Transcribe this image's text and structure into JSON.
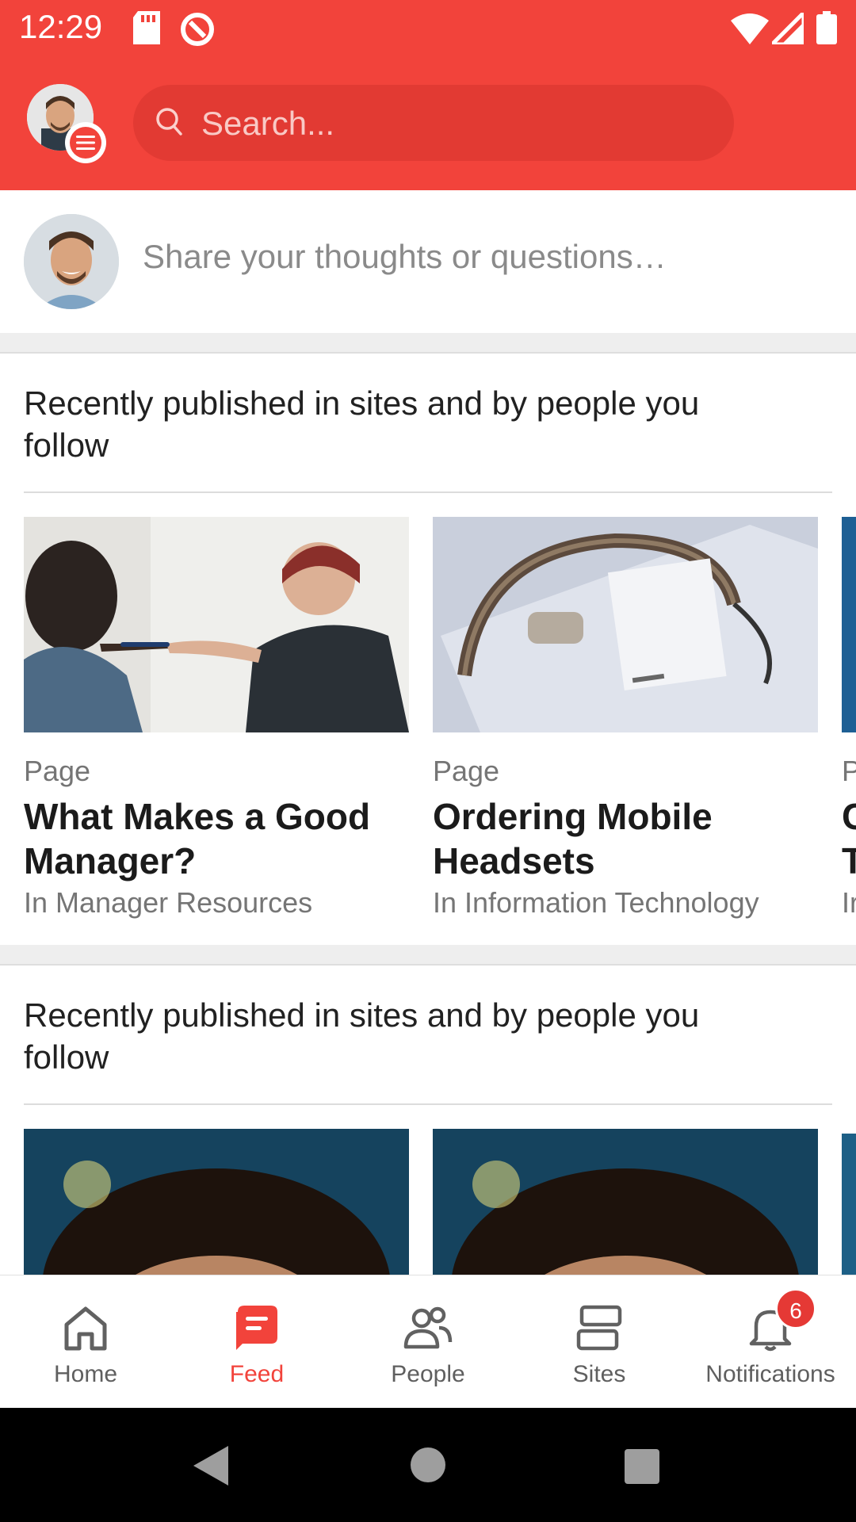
{
  "status_bar": {
    "time": "12:29"
  },
  "search": {
    "placeholder": "Search..."
  },
  "composer": {
    "placeholder": "Share your thoughts or questions…"
  },
  "sections": [
    {
      "title": "Recently published in sites and by people you follow",
      "cards": [
        {
          "type": "Page",
          "title": "What Makes a Good Manager?",
          "subtitle": "In Manager Resources",
          "image": "whiteboard-photo"
        },
        {
          "type": "Page",
          "title": "Ordering Mobile Headsets",
          "subtitle": "In Information Technology",
          "image": "headset-box-photo"
        },
        {
          "type": "P",
          "title": "C T",
          "subtitle": "Ir"
        }
      ]
    },
    {
      "title": "Recently published in sites and by people you follow",
      "cards": [
        {
          "image": "portrait-photo"
        },
        {
          "image": "portrait-photo"
        }
      ]
    }
  ],
  "bottom_nav": {
    "items": [
      {
        "label": "Home",
        "icon": "home-icon"
      },
      {
        "label": "Feed",
        "icon": "feed-icon",
        "active": true
      },
      {
        "label": "People",
        "icon": "people-icon"
      },
      {
        "label": "Sites",
        "icon": "sites-icon"
      },
      {
        "label": "Notifications",
        "icon": "bell-icon",
        "badge": "6"
      }
    ]
  },
  "colors": {
    "brand": "#f2433b",
    "badge": "#e53935"
  }
}
